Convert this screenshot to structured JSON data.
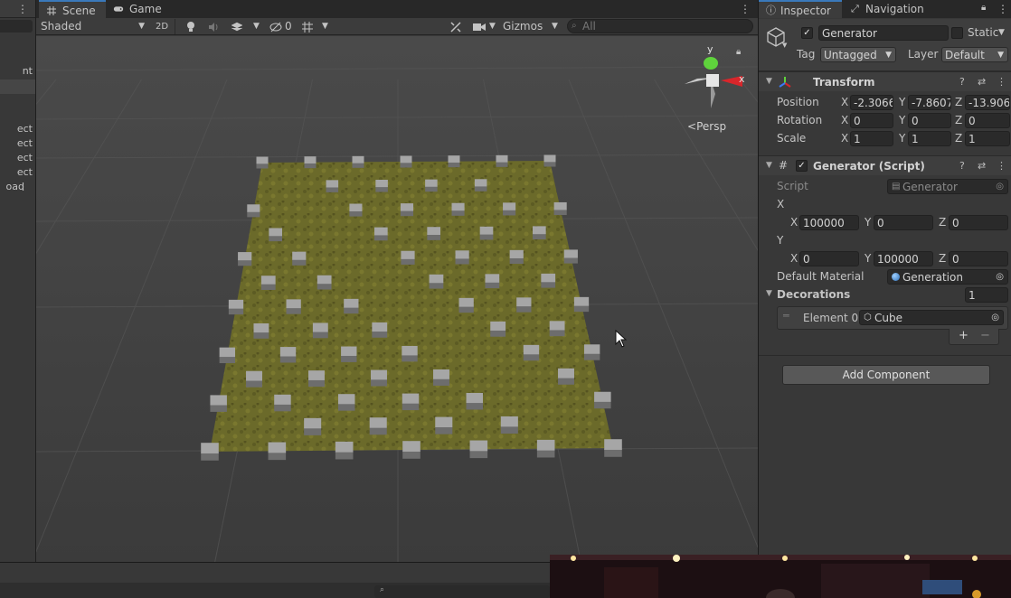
{
  "hierarchy": {
    "visible_item_fragments": [
      "nt",
      "ect",
      "ect",
      "ect",
      "ect",
      "oad"
    ]
  },
  "scene_tabs": [
    {
      "label": "Scene",
      "icon": "grid-icon",
      "active": true
    },
    {
      "label": "Game",
      "icon": "gamepad-icon",
      "active": false
    }
  ],
  "scene_toolbar": {
    "draw_mode": "Shaded",
    "toggle_2d": "2D",
    "hidden_count": "0",
    "gizmos": "Gizmos",
    "search_placeholder": "All"
  },
  "gizmo": {
    "y_label": "y",
    "x_label": "x",
    "projection": "Persp"
  },
  "inspector_tabs": [
    {
      "label": "Inspector",
      "icon": "info-icon",
      "active": true
    },
    {
      "label": "Navigation",
      "icon": "compass-icon",
      "active": false
    }
  ],
  "object": {
    "name": "Generator",
    "static_label": "Static",
    "tag_label": "Tag",
    "tag_value": "Untagged",
    "layer_label": "Layer",
    "layer_value": "Default"
  },
  "transform": {
    "title": "Transform",
    "rows": [
      {
        "label": "Position",
        "x": "-2.3066",
        "y": "-7.8607",
        "z": "-13.906"
      },
      {
        "label": "Rotation",
        "x": "0",
        "y": "0",
        "z": "0"
      },
      {
        "label": "Scale",
        "x": "1",
        "y": "1",
        "z": "1"
      }
    ]
  },
  "generator": {
    "title": "Generator (Script)",
    "script_label": "Script",
    "script_value": "Generator",
    "x_label": "X",
    "x_vec": {
      "x": "100000",
      "y": "0",
      "z": "0"
    },
    "y_label": "Y",
    "y_vec": {
      "x": "0",
      "y": "100000",
      "z": "0"
    },
    "default_material_label": "Default Material",
    "default_material_value": "Generation",
    "decorations_label": "Decorations",
    "decorations_count": "1",
    "element0_label": "Element 0",
    "element0_value": "Cube",
    "add_symbol": "+",
    "remove_symbol": "−"
  },
  "add_component_label": "Add Component",
  "axis_letters": {
    "x": "X",
    "y": "Y",
    "z": "Z"
  },
  "colors": {
    "accent": "#3a79bb",
    "gizmo_y": "#5fd33c",
    "gizmo_x": "#d8262b",
    "terrain": "#6b6a2a",
    "cube": "#9a9a9a"
  }
}
